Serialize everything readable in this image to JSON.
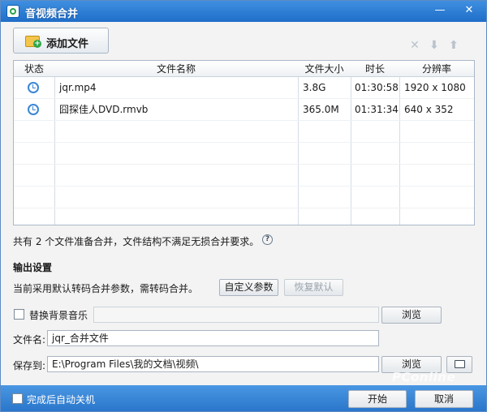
{
  "window": {
    "title": "音视频合并",
    "minimize_glyph": "—",
    "close_glyph": "✕"
  },
  "toolbar": {
    "add_label": "添加文件",
    "icons": [
      "folder-add-icon",
      "delete-icon",
      "move-down-icon",
      "move-up-icon"
    ],
    "delete_glyph": "✕",
    "down_glyph": "⬇",
    "up_glyph": "⬆"
  },
  "table": {
    "headers": [
      "状态",
      "文件名称",
      "文件大小",
      "时长",
      "分辨率"
    ],
    "rows": [
      {
        "status_icon": "clock-icon",
        "name": "jqr.mp4",
        "size": "3.8G",
        "duration": "01:30:58",
        "resolution": "1920 x 1080"
      },
      {
        "status_icon": "clock-icon",
        "name": "囧探佳人DVD.rmvb",
        "size": "365.0M",
        "duration": "01:31:34",
        "resolution": "640 x 352"
      }
    ]
  },
  "info": {
    "text": "共有 2 个文件准备合并，文件结构不满足无损合并要求。",
    "help_glyph": "?"
  },
  "output": {
    "section_title": "输出设置",
    "param_text": "当前采用默认转码合并参数，需转码合并。",
    "custom_params_label": "自定义参数",
    "restore_default_label": "恢复默认",
    "replace_music_label": "替换背景音乐",
    "replace_music_checked": false,
    "music_path": "",
    "browse_label": "浏览",
    "filename_label": "文件名:",
    "filename_value": "jqr_合并文件",
    "save_label": "保存到:",
    "save_path": "E:\\Program Files\\我的文档\\视频\\"
  },
  "footer": {
    "auto_shutdown_label": "完成后自动关机",
    "auto_shutdown_checked": false,
    "start_label": "开始",
    "cancel_label": "取消"
  },
  "watermark": "PConline"
}
